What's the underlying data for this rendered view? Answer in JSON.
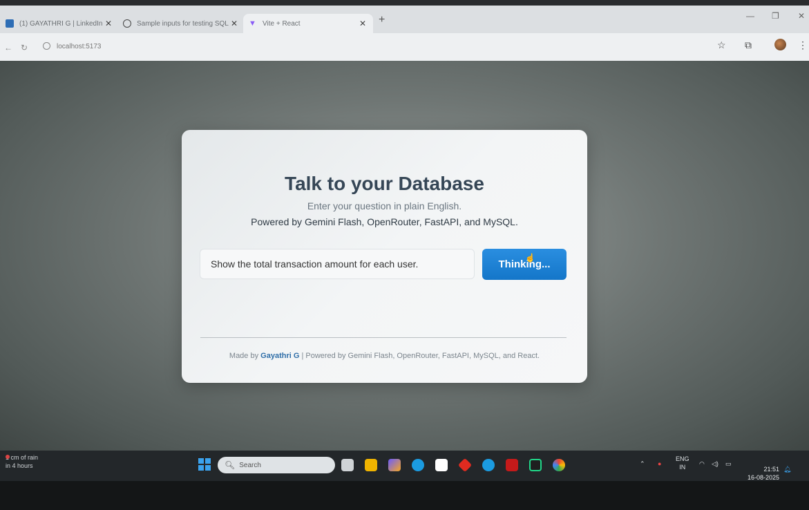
{
  "browser": {
    "tabs": [
      {
        "label": "(1) GAYATHRI G | LinkedIn",
        "color": "#2d6db5"
      },
      {
        "label": "Sample inputs for testing SQL",
        "color": "#444444"
      },
      {
        "label": "Vite + React",
        "color": "#8a5cf6"
      }
    ],
    "new_tab": "+",
    "url": "localhost:5173"
  },
  "app": {
    "title": "Talk to your Database",
    "subtitle": "Enter your question in plain English.",
    "powered_by": "Powered by Gemini Flash, OpenRouter, FastAPI, and MySQL.",
    "query_value": "Show the total transaction amount for each user.",
    "button_label": "Thinking...",
    "footer": {
      "prefix": "Made by ",
      "author": "Gayathri G",
      "suffix": " | Powered by Gemini Flash, OpenRouter, FastAPI, MySQL, and React."
    }
  },
  "taskbar": {
    "weather_line1": "1 cm of rain",
    "weather_line2": "in 4 hours",
    "search_placeholder": "Search",
    "lang_line1": "ENG",
    "lang_line2": "IN",
    "time": "21:51",
    "date": "16-08-2025"
  },
  "colors": {
    "accent": "#1a7fd4",
    "title": "#354656",
    "author_link": "#2f6ea8"
  }
}
